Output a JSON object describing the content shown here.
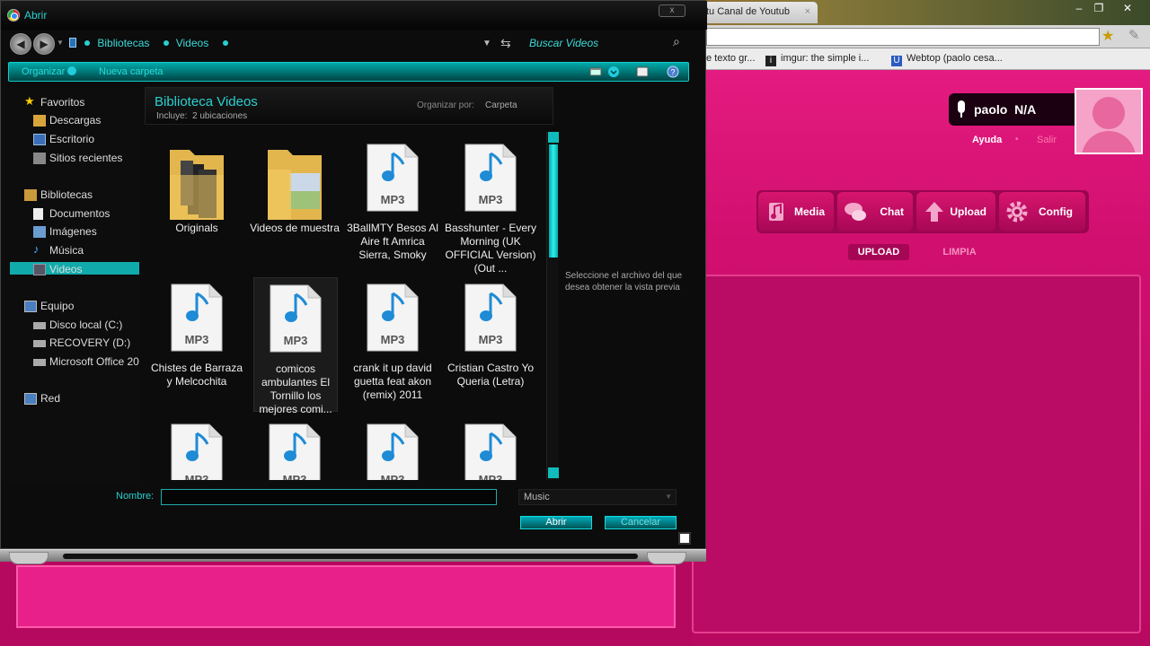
{
  "dialog": {
    "title": "Abrir",
    "close": "x",
    "breadcrumbs": [
      "Bibliotecas",
      "Videos"
    ],
    "search_placeholder": "Buscar Videos",
    "toolbar": {
      "organize": "Organizar",
      "new_folder": "Nueva carpeta"
    },
    "sidebar": {
      "favorites": {
        "label": "Favoritos",
        "items": [
          "Descargas",
          "Escritorio",
          "Sitios recientes"
        ]
      },
      "libraries": {
        "label": "Bibliotecas",
        "items": [
          "Documentos",
          "Imágenes",
          "Música",
          "Videos"
        ],
        "selected": "Videos"
      },
      "computer": {
        "label": "Equipo",
        "items": [
          "Disco local (C:)",
          "RECOVERY (D:)",
          "Microsoft Office 20"
        ]
      },
      "network": {
        "label": "Red"
      }
    },
    "library": {
      "title": "Biblioteca Videos",
      "includes_label": "Incluye:",
      "includes_value": "2 ubicaciones",
      "arrange_label": "Organizar por:",
      "arrange_value": "Carpeta"
    },
    "files": [
      {
        "type": "folder",
        "name": "Originals"
      },
      {
        "type": "folder",
        "name": "Videos de muestra"
      },
      {
        "type": "mp3",
        "name": "3BallMTY Besos Al Aire ft Amrica Sierra, Smoky"
      },
      {
        "type": "mp3",
        "name": "Basshunter - Every Morning (UK OFFICIAL Version) (Out ..."
      },
      {
        "type": "mp3",
        "name": "Chistes de Barraza y Melcochita"
      },
      {
        "type": "mp3",
        "name": "comicos ambulantes El Tornillo los mejores comi..."
      },
      {
        "type": "mp3",
        "name": "crank it up david guetta feat akon (remix) 2011"
      },
      {
        "type": "mp3",
        "name": "Cristian Castro Yo Queria (Letra)"
      },
      {
        "type": "mp3",
        "name": ""
      },
      {
        "type": "mp3",
        "name": ""
      },
      {
        "type": "mp3",
        "name": ""
      },
      {
        "type": "mp3",
        "name": ""
      }
    ],
    "mp3_badge": "MP3",
    "preview_text": "Seleccione el archivo del que desea obtener la vista previa",
    "filename_label": "Nombre:",
    "filename_value": "",
    "filter_value": "Music",
    "open_button": "Abrir",
    "cancel_button": "Cancelar"
  },
  "browser": {
    "tab_title": "tu Canal de Youtub",
    "bookmarks": [
      "e texto gr...",
      "imgur: the simple i...",
      "Webtop (paolo cesa..."
    ],
    "window_controls": [
      "–",
      "❐",
      "✕"
    ]
  },
  "site": {
    "username": "paolo",
    "status": "N/A",
    "help": "Ayuda",
    "logout": "Salir",
    "nav": [
      "Media",
      "Chat",
      "Upload",
      "Config"
    ],
    "subnav": [
      "UPLOAD",
      "LIMPIA"
    ]
  },
  "colors": {
    "accent": "#2ad0d0",
    "pink": "#d10f6f"
  }
}
